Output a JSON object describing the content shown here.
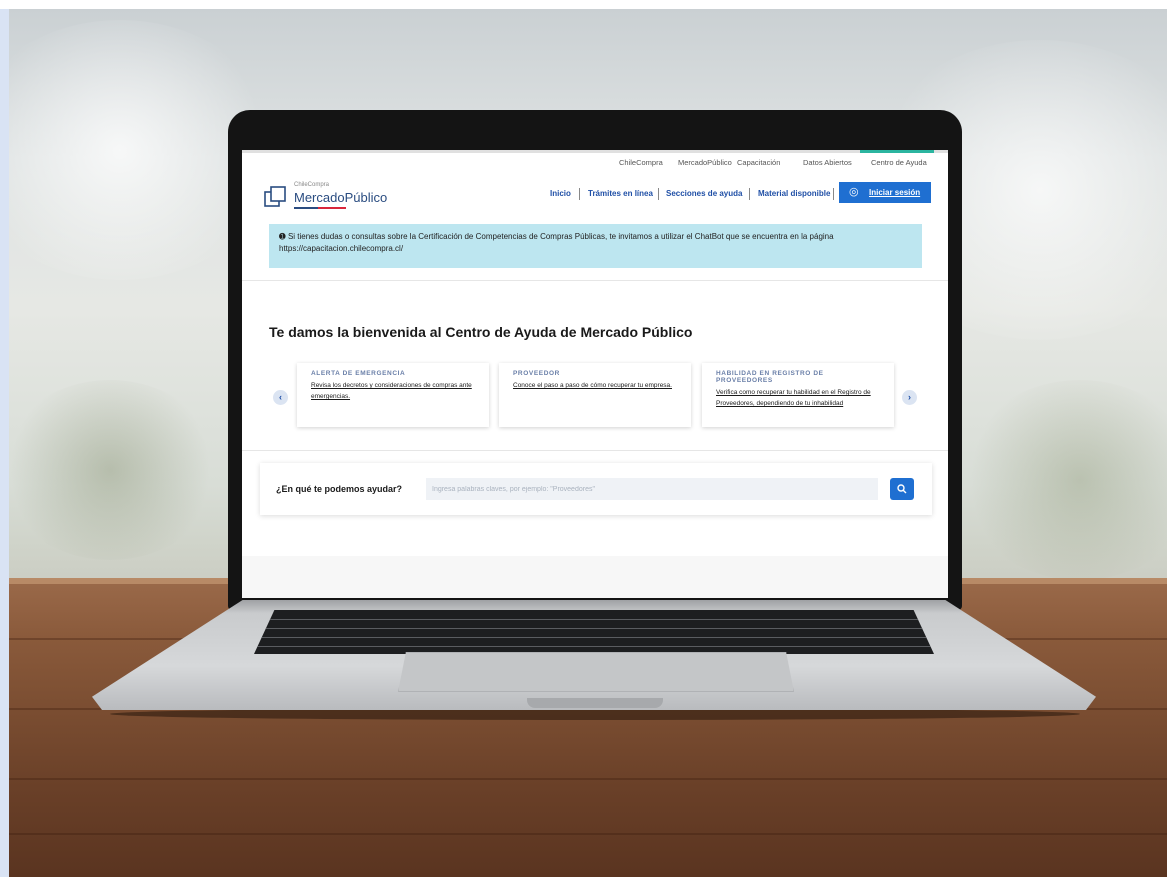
{
  "top_links": [
    "ChileCompra",
    "MercadoPúblico",
    "Capacitación",
    "Datos Abiertos",
    "Centro de Ayuda"
  ],
  "logo": {
    "small": "ChileCompra",
    "big": "MercadoPúblico"
  },
  "main_nav": [
    "Inicio",
    "Trámites en línea",
    "Secciones de ayuda",
    "Material disponible"
  ],
  "login": {
    "label": "Iniciar sesión",
    "icon": "fingerprint-icon"
  },
  "alert": {
    "icon": "info-icon",
    "text": "Si tienes dudas o consultas sobre la Certificación de Competencias de Compras Públicas, te invitamos a utilizar el ChatBot que se encuentra en la página https://capacitacion.chilecompra.cl/"
  },
  "welcome_title": "Te damos la bienvenida al Centro de Ayuda de Mercado Público",
  "cards": [
    {
      "title": "ALERTA DE EMERGENCIA",
      "text": "Revisa los decretos y consideraciones de compras ante emergencias."
    },
    {
      "title": "PROVEEDOR",
      "text": "Conoce el paso a paso de cómo recuperar tu empresa."
    },
    {
      "title": "HABILIDAD EN REGISTRO DE PROVEEDORES",
      "text": "Verifica como recuperar tu habilidad en el Registro de Proveedores, dependiendo de tu inhabilidad"
    }
  ],
  "carousel": {
    "prev": "‹",
    "next": "›"
  },
  "search": {
    "label": "¿En qué te podemos ayudar?",
    "placeholder": "Ingresa palabras claves, por ejemplo: \"Proveedores\"",
    "value": ""
  },
  "colors": {
    "primary": "#1f6fd1",
    "nav_text": "#1f4fa6",
    "alert_bg": "#bde6f0",
    "accent": "#2bb5a0",
    "logo_red": "#d9263a"
  }
}
